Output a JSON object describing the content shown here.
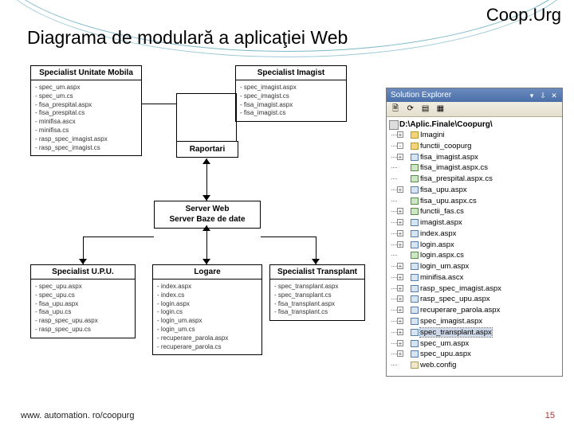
{
  "brand": "Coop.Urg",
  "title": "Diagrama de modulară a aplicaţiei Web",
  "footer_left": "www. automation. ro/coopurg",
  "footer_right": "15",
  "diagram": {
    "boxes": {
      "um": {
        "title": "Specialist Unitate Mobila",
        "items": [
          "- spec_um.aspx",
          "- spec_um.cs",
          "- fisa_prespital.aspx",
          "- fisa_prespital.cs",
          "- minifisa.ascx",
          "- minifisa.cs",
          "- rasp_spec_imagist.aspx",
          "- rasp_spec_imagist.cs"
        ]
      },
      "im": {
        "title": "Specialist Imagist",
        "items": [
          "- spec_imagist.aspx",
          "- spec_imagist.cs",
          "- fisa_imagist.aspx",
          "- fisa_imagist.cs"
        ]
      },
      "upu": {
        "title": "Specialist U.P.U.",
        "items": [
          "- spec_upu.aspx",
          "- spec_upu.cs",
          "- fisa_upu.aspx",
          "- fisa_upu.cs",
          "- rasp_spec_upu.aspx",
          "- rasp_spec_upu.cs"
        ]
      },
      "log": {
        "title": "Logare",
        "items": [
          "- index.aspx",
          "- index.cs",
          "- login.aspx",
          "- login.cs",
          "- login_um.aspx",
          "- login_um.cs",
          "- recuperare_parola.aspx",
          "- recuperare_parola.cs"
        ]
      },
      "tr": {
        "title": "Specialist Transplant",
        "items": [
          "- spec_transplant.aspx",
          "- spec_transplant.cs",
          "- fisa_transplant.aspx",
          "- fisa_transplant.cs"
        ]
      }
    },
    "raportari": "Raportari",
    "server": "Server Web<br>Server Baze de date"
  },
  "explorer": {
    "title": "Solution Explorer",
    "root": "D:\\Aplic.Finale\\Coopurg\\",
    "items": [
      {
        "t": "Imagini",
        "ic": "folder",
        "exp": "+"
      },
      {
        "t": "functii_coopurg",
        "ic": "folder",
        "exp": "-"
      },
      {
        "t": "fisa_imagist.aspx",
        "ic": "aspx",
        "exp": "+"
      },
      {
        "t": "fisa_imagist.aspx.cs",
        "ic": "cs",
        "exp": ""
      },
      {
        "t": "fisa_prespital.aspx.cs",
        "ic": "cs",
        "exp": ""
      },
      {
        "t": "fisa_upu.aspx",
        "ic": "aspx",
        "exp": "+"
      },
      {
        "t": "fisa_upu.aspx.cs",
        "ic": "cs",
        "exp": ""
      },
      {
        "t": "functii_fas.cs",
        "ic": "cs",
        "exp": "+"
      },
      {
        "t": "imagist.aspx",
        "ic": "aspx",
        "exp": "+"
      },
      {
        "t": "index.aspx",
        "ic": "aspx",
        "exp": "+"
      },
      {
        "t": "login.aspx",
        "ic": "aspx",
        "exp": "+"
      },
      {
        "t": "login.aspx.cs",
        "ic": "cs",
        "exp": ""
      },
      {
        "t": "login_um.aspx",
        "ic": "aspx",
        "exp": "+"
      },
      {
        "t": "minifisa.ascx",
        "ic": "aspx",
        "exp": "+"
      },
      {
        "t": "rasp_spec_imagist.aspx",
        "ic": "aspx",
        "exp": "+"
      },
      {
        "t": "rasp_spec_upu.aspx",
        "ic": "aspx",
        "exp": "+"
      },
      {
        "t": "recuperare_parola.aspx",
        "ic": "aspx",
        "exp": "+"
      },
      {
        "t": "spec_imagist.aspx",
        "ic": "aspx",
        "exp": "+"
      },
      {
        "t": "spec_transplant.aspx",
        "ic": "aspx",
        "exp": "+",
        "sel": true
      },
      {
        "t": "spec_um.aspx",
        "ic": "aspx",
        "exp": "+"
      },
      {
        "t": "spec_upu.aspx",
        "ic": "aspx",
        "exp": "+"
      },
      {
        "t": "web.config",
        "ic": "cfg",
        "exp": ""
      }
    ]
  }
}
